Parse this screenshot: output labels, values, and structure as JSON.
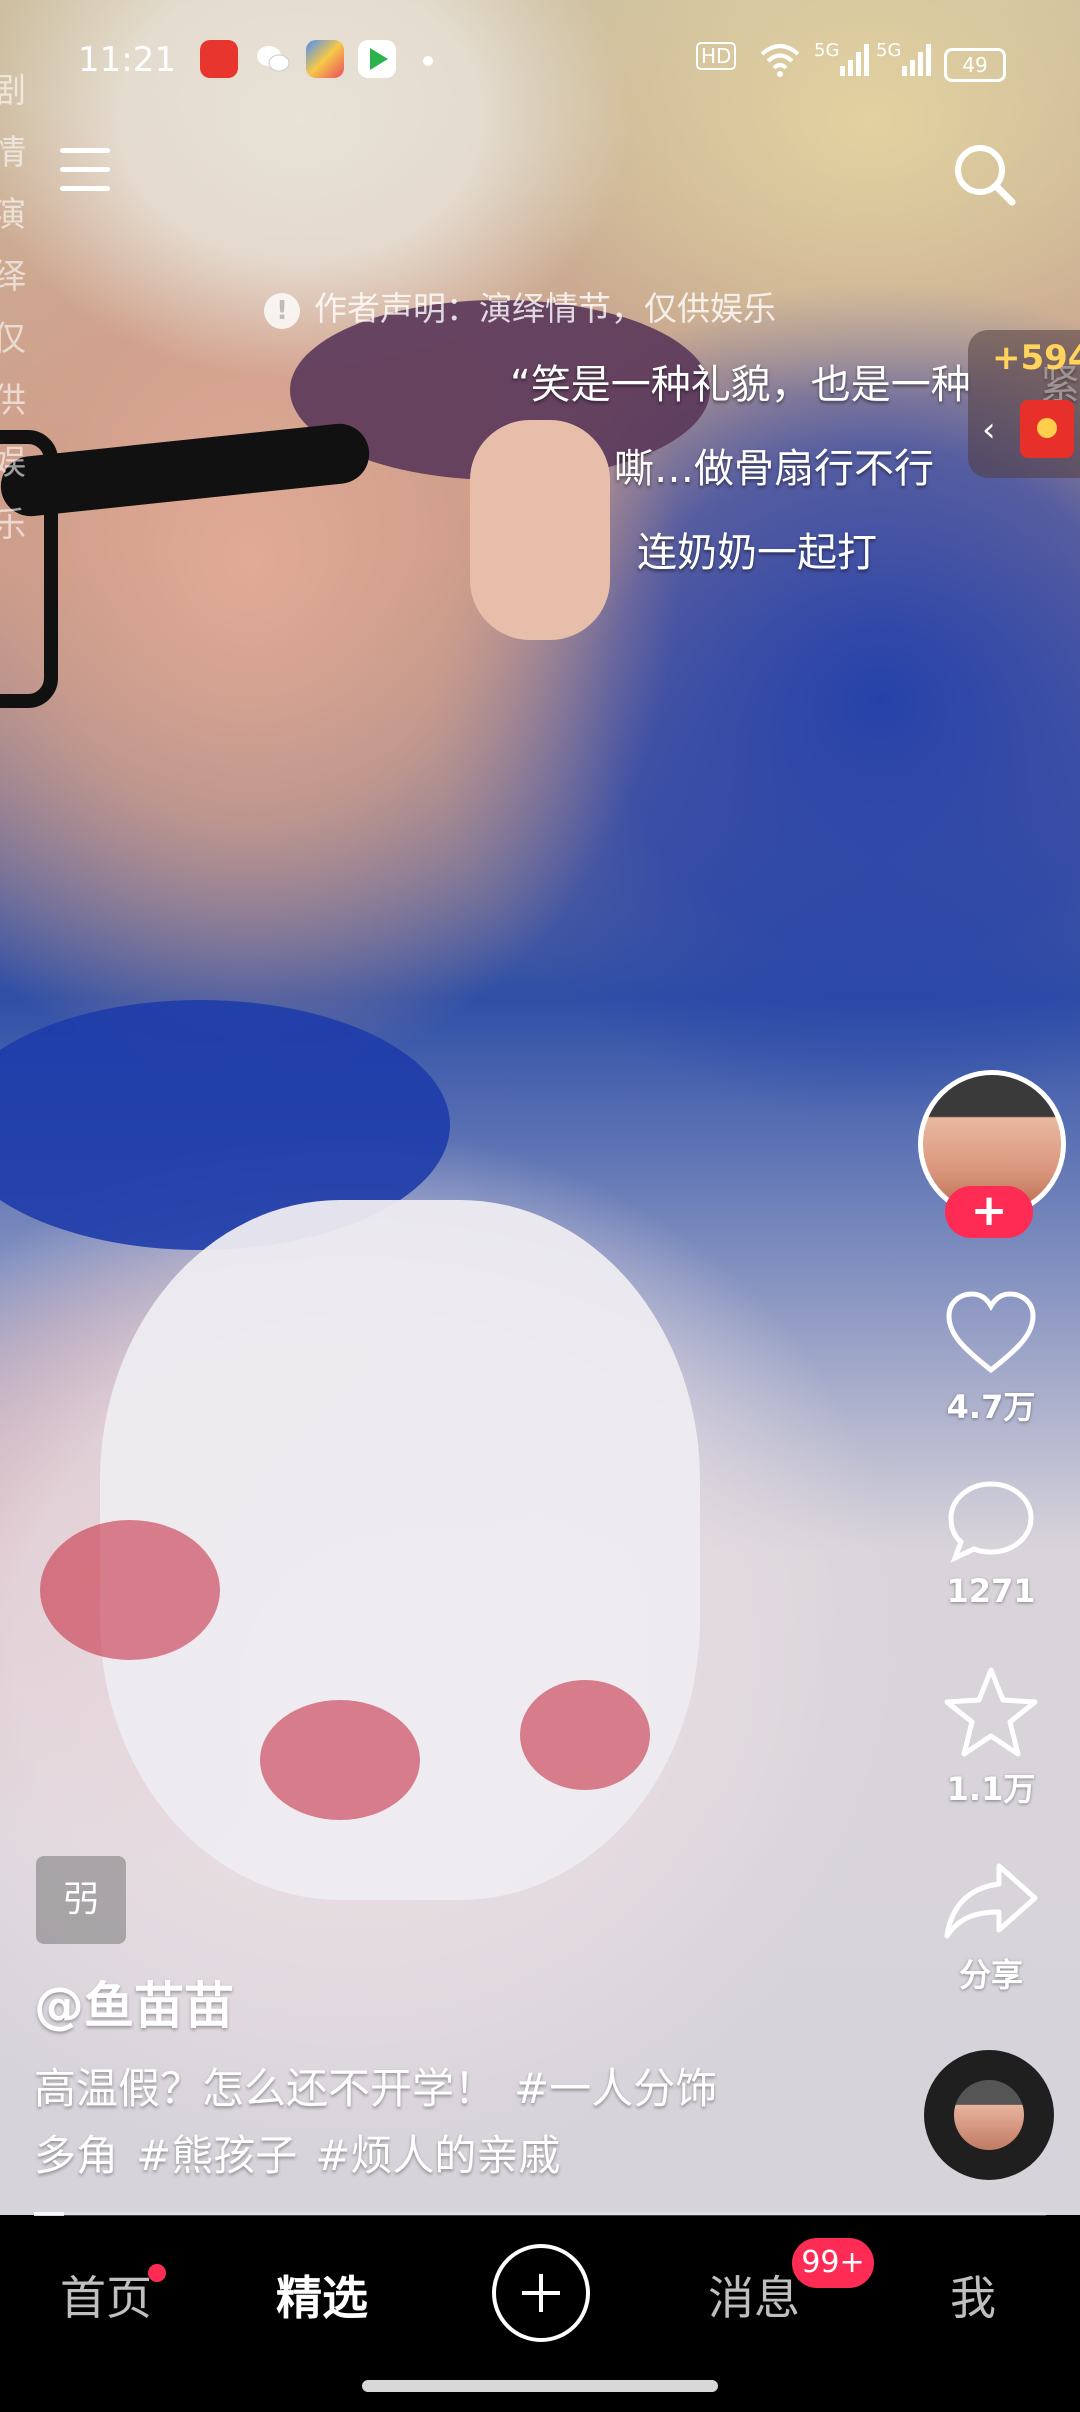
{
  "status_bar": {
    "time": "11:21",
    "hd": "HD",
    "net1": "5G",
    "net2": "5G",
    "battery": "49"
  },
  "overlay": {
    "vertical_side_text": "剧情演绎仅供娱乐",
    "disclaimer": "作者声明：演绎情节，仅供娱乐",
    "captions": [
      "“笑是一种礼貌，也是一种",
      "嘶…做骨扇行不行",
      "连奶奶一起打"
    ],
    "caption_overflow_glyph": "紧",
    "red_packet_amount": "+594"
  },
  "actions": {
    "likes": "4.7万",
    "comments": "1271",
    "favorites": "1.1万",
    "share_label": "分享",
    "follow_symbol": "+"
  },
  "post": {
    "badge_glyph": "弜",
    "username": "@鱼苗苗",
    "description_line1": "高温假？怎么还不开学！",
    "tags_line1": "#一人分饰",
    "description_line2": "多角",
    "tags_line2": [
      "#熊孩子",
      "#烦人的亲戚"
    ]
  },
  "nav": {
    "home": "首页",
    "featured": "精选",
    "messages": "消息",
    "messages_badge": "99+",
    "me": "我"
  },
  "colors": {
    "accent": "#fe2c55",
    "nav_background": "#000000",
    "red_packet": "#e8302a",
    "red_packet_amount": "#ffd35c"
  }
}
